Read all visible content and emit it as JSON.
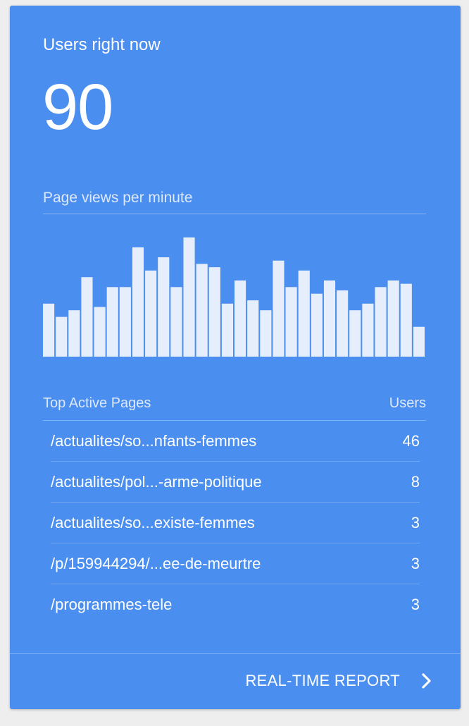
{
  "card": {
    "title": "Users right now",
    "active_users": "90",
    "pageviews_label": "Page views per minute",
    "background_color": "#4a8ef0"
  },
  "chart_data": {
    "type": "bar",
    "title": "",
    "xlabel": "",
    "ylabel": "",
    "values": [
      16,
      12,
      14,
      24,
      15,
      21,
      21,
      33,
      26,
      30,
      21,
      36,
      28,
      27,
      16,
      23,
      17,
      14,
      29,
      21,
      26,
      19,
      23,
      20,
      14,
      16,
      21,
      23,
      22,
      9
    ],
    "ylim": [
      0,
      40
    ],
    "bar_color": "#e6eefc",
    "grid": false
  },
  "table": {
    "header_page": "Top Active Pages",
    "header_users": "Users",
    "rows": [
      {
        "page": "/actualites/so...nfants-femmes",
        "users": "46"
      },
      {
        "page": "/actualites/pol...-arme-politique",
        "users": "8"
      },
      {
        "page": "/actualites/so...existe-femmes",
        "users": "3"
      },
      {
        "page": "/p/159944294/...ee-de-meurtre",
        "users": "3"
      },
      {
        "page": "/programmes-tele",
        "users": "3"
      }
    ]
  },
  "footer": {
    "link_label": "REAL-TIME REPORT",
    "icon": "chevron-right-icon"
  }
}
